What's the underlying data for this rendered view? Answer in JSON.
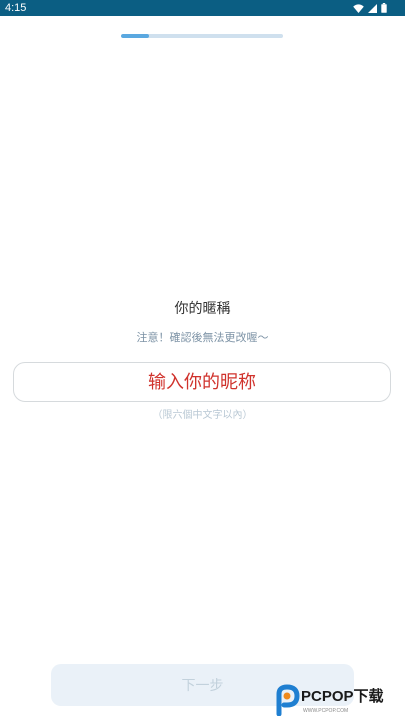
{
  "status_bar": {
    "time": "4:15",
    "icons": [
      "wifi-icon",
      "signal-icon",
      "battery-icon"
    ],
    "color": "#0b5e83"
  },
  "progress": {
    "value_percent": 17,
    "fill_color": "#5aa8e0",
    "track_color": "#cfe0ee"
  },
  "form": {
    "title": "你的暱稱",
    "notice": "注意！確認後無法更改喔～",
    "input_placeholder": "输入你的昵称",
    "input_value": "",
    "hint": "（限六個中文字以內）",
    "accent_color": "#d0322c"
  },
  "actions": {
    "next_label": "下一步",
    "next_bg": "#eaf1f8",
    "next_text_color": "#c2d1dc"
  },
  "watermark": {
    "text": "PCPOP下载",
    "subtext": "WWW.PCPOP.COM"
  }
}
